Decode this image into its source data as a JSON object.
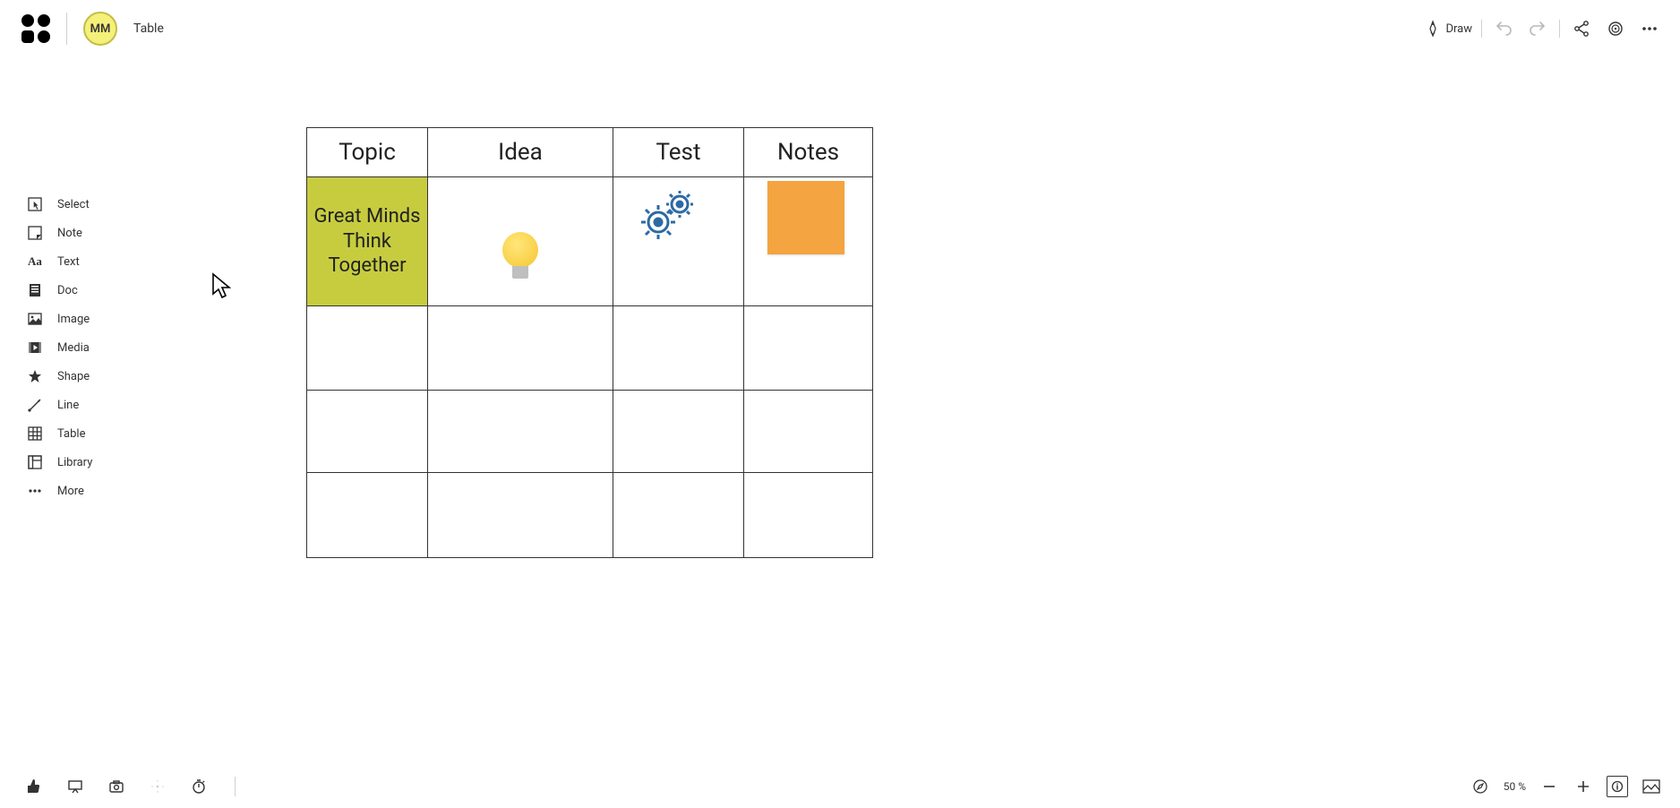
{
  "header": {
    "avatar_initials": "MM",
    "doc_title": "Table",
    "draw_label": "Draw"
  },
  "sidebar": {
    "items": [
      {
        "id": "select",
        "label": "Select",
        "icon": "select-icon"
      },
      {
        "id": "note",
        "label": "Note",
        "icon": "note-icon"
      },
      {
        "id": "text",
        "label": "Text",
        "icon": "text-aa-icon"
      },
      {
        "id": "doc",
        "label": "Doc",
        "icon": "doc-icon"
      },
      {
        "id": "image",
        "label": "Image",
        "icon": "image-icon"
      },
      {
        "id": "media",
        "label": "Media",
        "icon": "media-icon"
      },
      {
        "id": "shape",
        "label": "Shape",
        "icon": "shape-star-icon"
      },
      {
        "id": "line",
        "label": "Line",
        "icon": "line-icon"
      },
      {
        "id": "table",
        "label": "Table",
        "icon": "table-grid-icon"
      },
      {
        "id": "library",
        "label": "Library",
        "icon": "library-icon"
      },
      {
        "id": "more",
        "label": "More",
        "icon": "more-dots-icon"
      }
    ]
  },
  "table": {
    "headers": [
      "Topic",
      "Idea",
      "Test",
      "Notes"
    ],
    "rows": [
      {
        "topic_text": "Great Minds Think Together",
        "topic_bg": "#c7cc3f",
        "idea_icon": "lightbulb-icon",
        "test_icon": "gears-icon",
        "notes_note_color": "#f4a440"
      },
      {
        "topic_text": "",
        "idea_icon": null,
        "test_icon": null,
        "notes_note_color": null
      },
      {
        "topic_text": "",
        "idea_icon": null,
        "test_icon": null,
        "notes_note_color": null
      },
      {
        "topic_text": "",
        "idea_icon": null,
        "test_icon": null,
        "notes_note_color": null
      }
    ]
  },
  "bottom": {
    "zoom_text": "50 %"
  }
}
